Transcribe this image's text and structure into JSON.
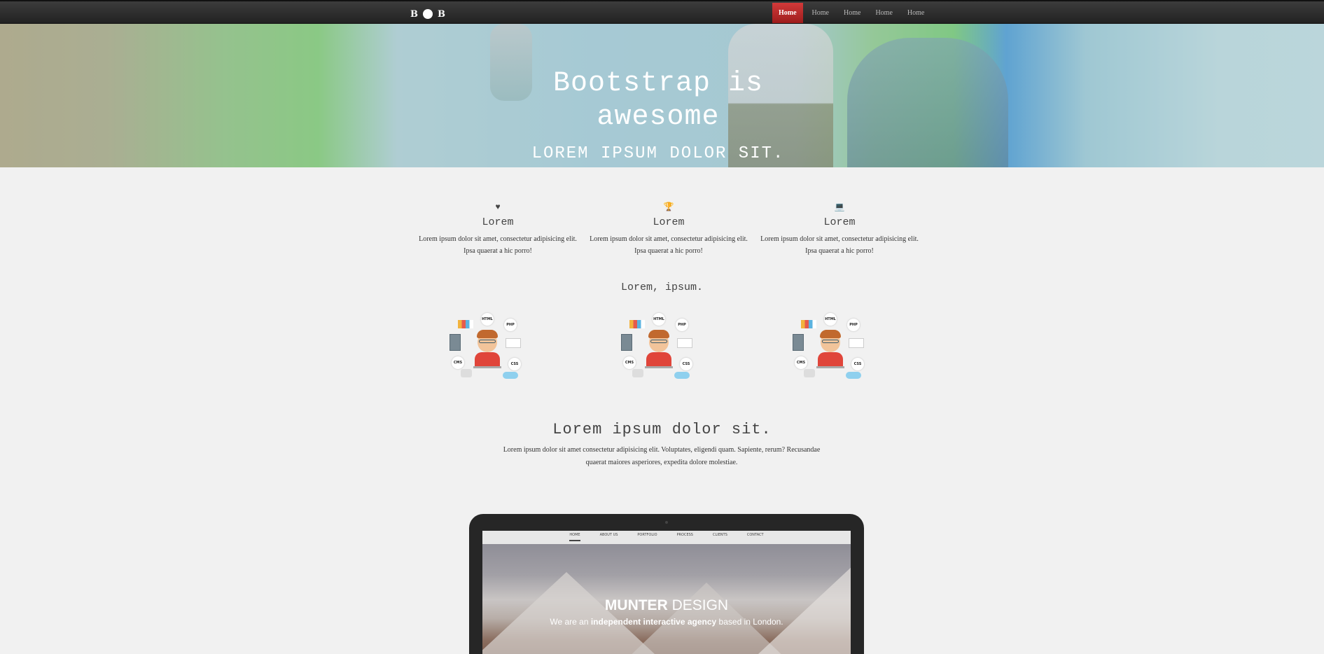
{
  "navbar": {
    "brand_left": "B",
    "brand_right": "B",
    "items": [
      {
        "label": "Home",
        "active": true
      },
      {
        "label": "Home",
        "active": false
      },
      {
        "label": "Home",
        "active": false
      },
      {
        "label": "Home",
        "active": false
      },
      {
        "label": "Home",
        "active": false
      }
    ]
  },
  "hero": {
    "title": "Bootstrap is awesome",
    "subtitle": "LOREM IPSUM DOLOR SIT."
  },
  "features": [
    {
      "icon": "heart-icon",
      "glyph": "♥",
      "title": "Lorem",
      "text": "Lorem ipsum dolor sit amet, consectetur adipisicing elit. Ipsa quaerat a hic porro!"
    },
    {
      "icon": "trophy-icon",
      "glyph": "🏆",
      "title": "Lorem",
      "text": "Lorem ipsum dolor sit amet, consectetur adipisicing elit. Ipsa quaerat a hic porro!"
    },
    {
      "icon": "laptop-icon",
      "glyph": "💻",
      "title": "Lorem",
      "text": "Lorem ipsum dolor sit amet, consectetur adipisicing elit. Ipsa quaerat a hic porro!"
    }
  ],
  "skills_title": "Lorem, ipsum.",
  "avatar_bubbles": {
    "html": "HTML",
    "php": "PHP",
    "cms": "CMS",
    "css": "CSS"
  },
  "about": {
    "title": "Lorem ipsum dolor sit.",
    "text": "Lorem ipsum dolor sit amet consectetur adipisicing elit. Voluptates, eligendi quam. Sapiente, rerum? Recusandae quaerat maiores asperiores, expedita dolore molestiae."
  },
  "mockup": {
    "nav": [
      "HOME",
      "ABOUT US",
      "PORTFOLIO",
      "PROCESS",
      "CLIENTS",
      "CONTACT"
    ],
    "title_bold": "MUNTER",
    "title_rest": " DESIGN",
    "sub_a": "We are an ",
    "sub_bold": "independent interactive agency",
    "sub_b": " based in London."
  }
}
